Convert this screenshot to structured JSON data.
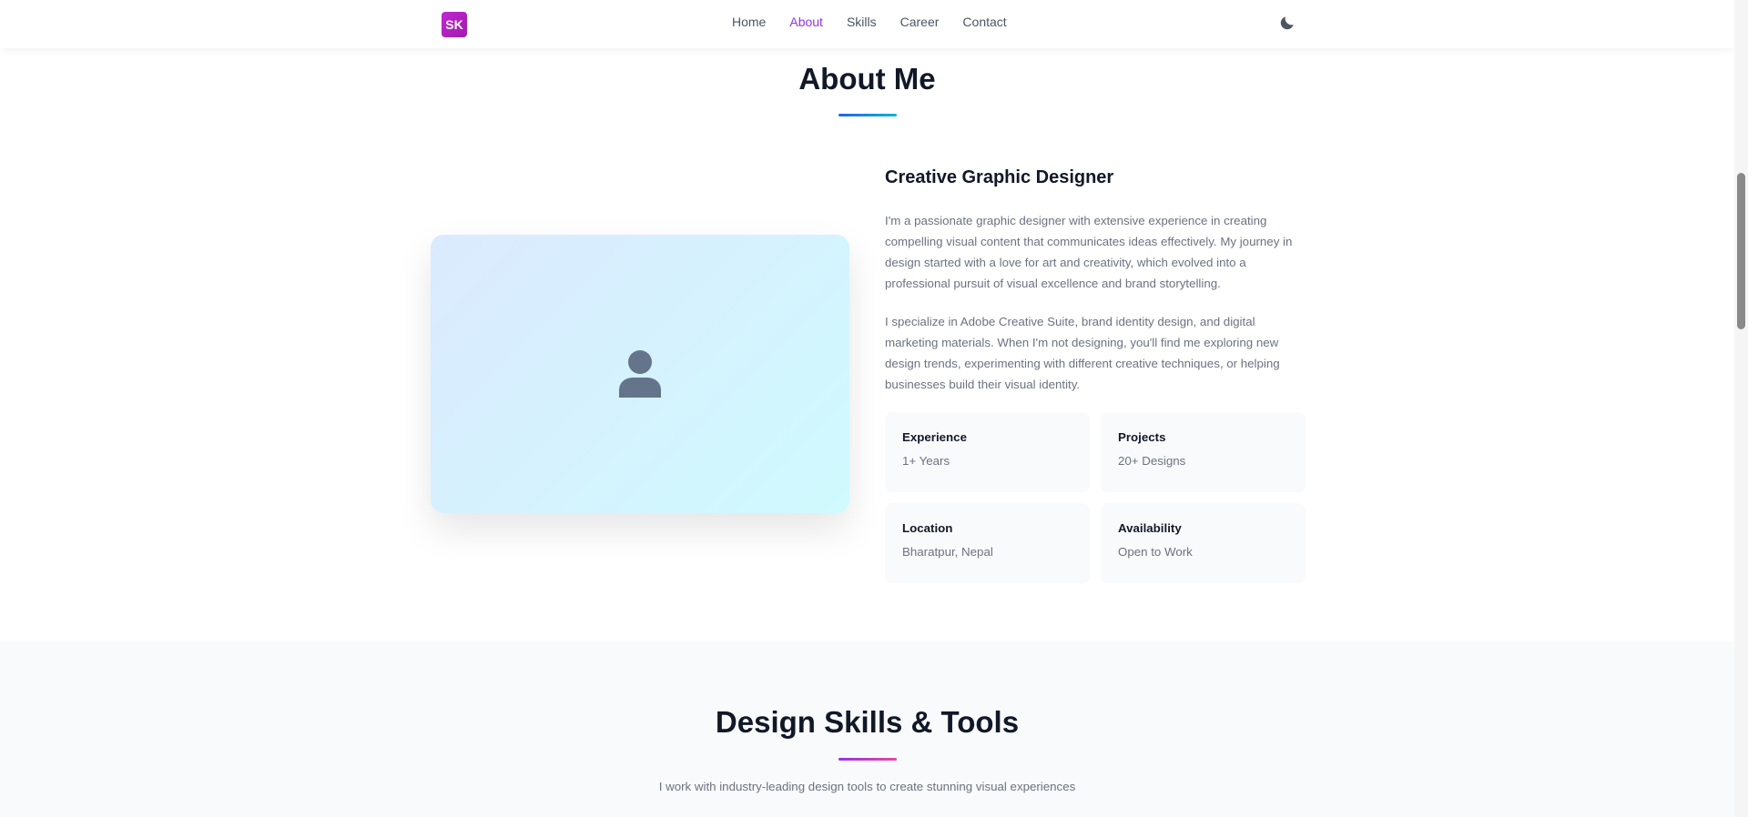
{
  "nav": {
    "logo": "SK",
    "links": [
      "Home",
      "About",
      "Skills",
      "Career",
      "Contact"
    ],
    "active": "About",
    "theme_icon": "moon-icon",
    "accent": "#9333ea"
  },
  "about": {
    "title": "About Me",
    "image_icon": "user-icon",
    "role": "Creative Graphic Designer",
    "paragraphs": [
      "I'm a passionate graphic designer with extensive experience in creating compelling visual content that communicates ideas effectively. My journey in design started with a love for art and creativity, which evolved into a professional pursuit of visual excellence and brand storytelling.",
      "I specialize in Adobe Creative Suite, brand identity design, and digital marketing materials. When I'm not designing, you'll find me exploring new design trends, experimenting with different creative techniques, or helping businesses build their visual identity."
    ],
    "info": [
      {
        "label": "Experience",
        "value": "1+ Years"
      },
      {
        "label": "Projects",
        "value": "20+ Designs"
      },
      {
        "label": "Location",
        "value": "Bharatpur, Nepal"
      },
      {
        "label": "Availability",
        "value": "Open to Work"
      }
    ]
  },
  "skills": {
    "title": "Design Skills & Tools",
    "subtitle": "I work with industry-leading design tools to create stunning visual experiences"
  }
}
